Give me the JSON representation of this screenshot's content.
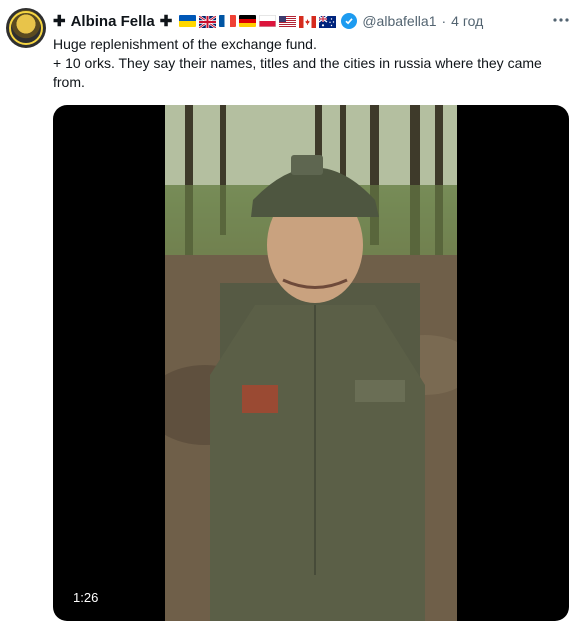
{
  "author": {
    "cross_left": "✚",
    "name": "Albina Fella",
    "cross_right": "✚",
    "handle": "@albafella1",
    "separator": "·",
    "time": "4 год"
  },
  "flags": [
    "ukraine-flag",
    "uk-flag",
    "france-flag",
    "germany-flag",
    "poland-flag",
    "usa-flag",
    "canada-flag",
    "australia-flag"
  ],
  "tweet": {
    "line1": "Huge replenishment of the exchange fund.",
    "line2": "+ 10 orks. They say their names, titles and the cities in russia where they came from."
  },
  "video": {
    "duration": "1:26"
  },
  "colors": {
    "verified": "#1d9bf0",
    "secondary_text": "#536471"
  }
}
